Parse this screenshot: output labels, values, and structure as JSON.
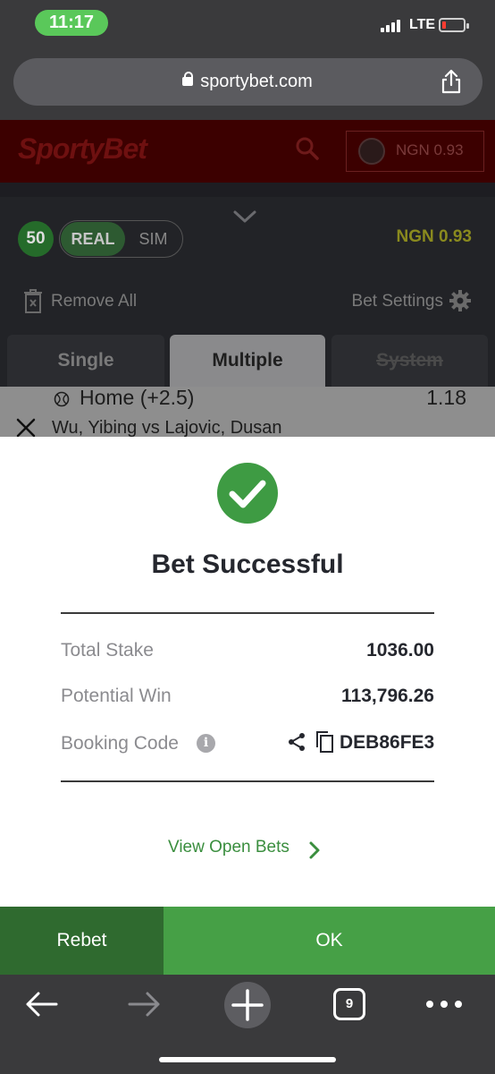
{
  "status_bar": {
    "time": "11:17",
    "network": "LTE"
  },
  "browser": {
    "url": "sportybet.com",
    "tab_count": "9"
  },
  "header": {
    "logo": "SportyBet",
    "balance": "NGN 0.93"
  },
  "betslip": {
    "count": "50",
    "mode_real": "REAL",
    "mode_sim": "SIM",
    "balance": "NGN 0.93",
    "remove_all": "Remove All",
    "bet_settings": "Bet Settings",
    "tabs": [
      "Single",
      "Multiple",
      "System"
    ],
    "selection": {
      "pick": "Home (+2.5)",
      "odds": "1.18",
      "match": "Wu, Yibing vs Lajovic, Dusan"
    }
  },
  "modal": {
    "title": "Bet Successful",
    "total_stake_label": "Total Stake",
    "total_stake": "1036.00",
    "potential_win_label": "Potential Win",
    "potential_win": "113,796.26",
    "booking_code_label": "Booking Code",
    "booking_code": "DEB86FE3",
    "view_open_bets": "View Open Bets"
  },
  "actions": {
    "rebet": "Rebet",
    "ok": "OK"
  },
  "colors": {
    "success_green": "#3e9b43",
    "ok_green": "#46a046",
    "rebet_green": "#2f6a2f",
    "link_green": "#3a8e3e"
  }
}
